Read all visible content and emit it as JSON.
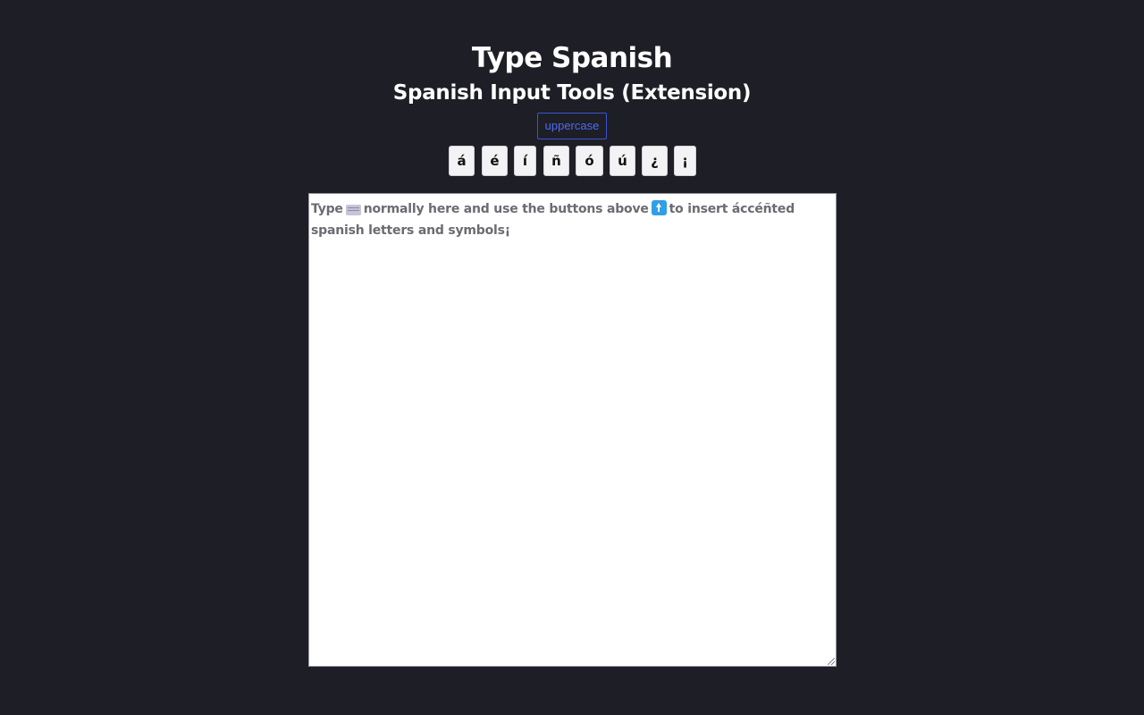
{
  "header": {
    "title": "Type Spanish",
    "subtitle": "Spanish Input Tools (Extension)"
  },
  "toolbar": {
    "uppercase_label": "uppercase",
    "keys": [
      {
        "name": "a-acute",
        "char": "á"
      },
      {
        "name": "e-acute",
        "char": "é"
      },
      {
        "name": "i-acute",
        "char": "í"
      },
      {
        "name": "n-tilde",
        "char": "ñ"
      },
      {
        "name": "o-acute",
        "char": "ó"
      },
      {
        "name": "u-acute",
        "char": "ú"
      },
      {
        "name": "inverted-question",
        "char": "¿"
      },
      {
        "name": "inverted-exclamation",
        "char": "¡"
      }
    ]
  },
  "editor": {
    "placeholder_parts": {
      "before_keyboard": "Type",
      "keyboard_icon": "keyboard-icon",
      "middle": "normally here and use the buttons above",
      "arrow_icon": "up-arrow-icon",
      "after_arrow": "to insert áccéñted spanish letters and symbols¡"
    }
  },
  "colors": {
    "background": "#1e1e26",
    "accent": "#4f6af0",
    "arrow_icon": "#2f9fe6"
  }
}
